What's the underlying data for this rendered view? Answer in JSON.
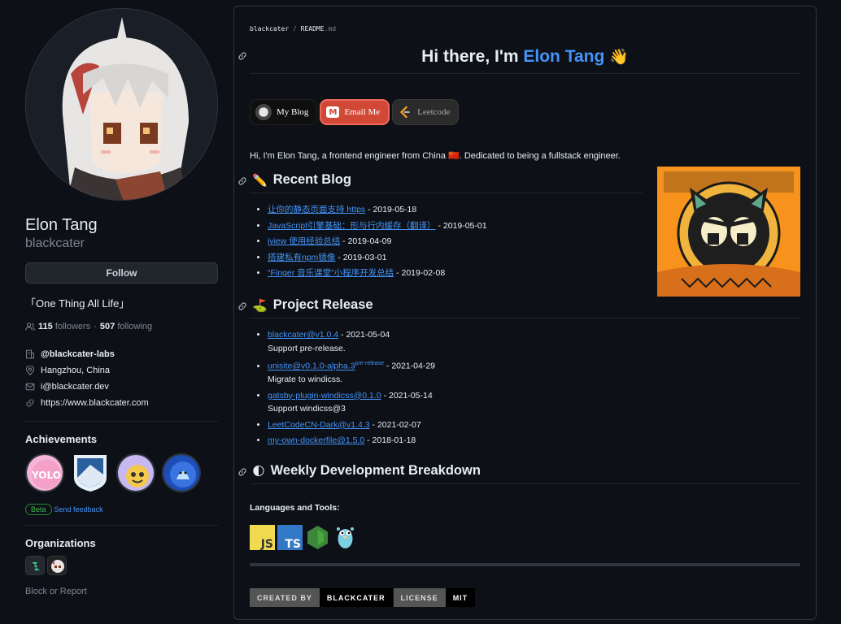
{
  "profile": {
    "fullname": "Elon Tang",
    "username": "blackcater",
    "follow_label": "Follow",
    "bio": "「One Thing All Life」",
    "followers_count": "115",
    "followers_label": "followers",
    "separator": "·",
    "following_count": "507",
    "following_label": "following",
    "org": "@blackcater-labs",
    "location": "Hangzhou, China",
    "email": "i@blackcater.dev",
    "website": "https://www.blackcater.com"
  },
  "achievements": {
    "heading": "Achievements",
    "badges": [
      "yolo-badge",
      "arctic-code-vault-badge",
      "quickdraw-badge",
      "pull-shark-badge"
    ],
    "beta_label": "Beta",
    "feedback_label": "Send feedback"
  },
  "organizations": {
    "heading": "Organizations",
    "items": [
      "s-org-logo",
      "blackcater-labs-logo"
    ]
  },
  "block_label": "Block or Report",
  "readme": {
    "crumb_user": "blackcater",
    "crumb_sep": "/",
    "crumb_file": "README",
    "crumb_ext": ".md",
    "hero_prefix": "Hi there, I'm ",
    "hero_name": "Elon Tang",
    "hero_emoji": "👋",
    "buttons": {
      "blog": "My Blog",
      "email": "Email Me",
      "leetcode": "Leetcode"
    },
    "intro": "Hi, I'm Elon Tang, a frontend engineer from China 🇨🇳. Dedicated to being a fullstack engineer.",
    "intro_flag": "cn",
    "recent_blog": {
      "heading": "Recent Blog",
      "emoji": "✏️",
      "items": [
        {
          "title": "让你的静态页面支持 https",
          "date": " - 2019-05-18"
        },
        {
          "title": "JavaScript引擎基础：形与行内缓存（翻译）",
          "date": " - 2019-05-01"
        },
        {
          "title": "iview 使用经验总结",
          "date": " - 2019-04-09"
        },
        {
          "title": "搭建私有npm镜像",
          "date": " - 2019-03-01"
        },
        {
          "title": "“Finger 音乐课堂”小程序开发总结",
          "date": " - 2019-02-08"
        }
      ]
    },
    "project_release": {
      "heading": "Project Release",
      "emoji": "⛳",
      "items": [
        {
          "title": "blackcater@v1.0.4",
          "sup": "",
          "date": " - 2021-05-04",
          "desc": "Support pre-release."
        },
        {
          "title": "unisite@v0.1.0-alpha.3",
          "sup": "pre-release",
          "date": " - 2021-04-29",
          "desc": "Migrate to windicss."
        },
        {
          "title": "gatsby-plugin-windicss@0.1.0",
          "sup": "",
          "date": " - 2021-05-14",
          "desc": "Support windicss@3"
        },
        {
          "title": "LeetCodeCN-Dark@v1.4.3",
          "sup": "",
          "date": " - 2021-02-07",
          "desc": ""
        },
        {
          "title": "my-own-dockerfile@1.5.0",
          "sup": "",
          "date": " - 2018-01-18",
          "desc": ""
        }
      ]
    },
    "weekly": {
      "heading": "Weekly Development Breakdown",
      "emoji": "🌓"
    },
    "languages_heading": "Languages and Tools:",
    "tools": [
      {
        "name": "javascript-icon",
        "label": "JS",
        "bg": "#f0db4f",
        "fg": "#323330"
      },
      {
        "name": "typescript-icon",
        "label": "TS",
        "bg": "#3178c6",
        "fg": "#ffffff"
      },
      {
        "name": "nodejs-icon",
        "label": "",
        "bg": "#3c873a",
        "fg": "#ffffff"
      },
      {
        "name": "golang-gopher-icon",
        "label": "",
        "bg": "#7ccfe0",
        "fg": "#ffffff"
      }
    ],
    "shields": [
      {
        "key": "CREATED BY",
        "value": "BLACKCATER"
      },
      {
        "key": "LICENSE",
        "value": "MIT"
      }
    ]
  },
  "colors": {
    "bg": "#0d1117",
    "accent": "#4493f8",
    "email_btn": "#d14836",
    "border": "#30363d"
  }
}
